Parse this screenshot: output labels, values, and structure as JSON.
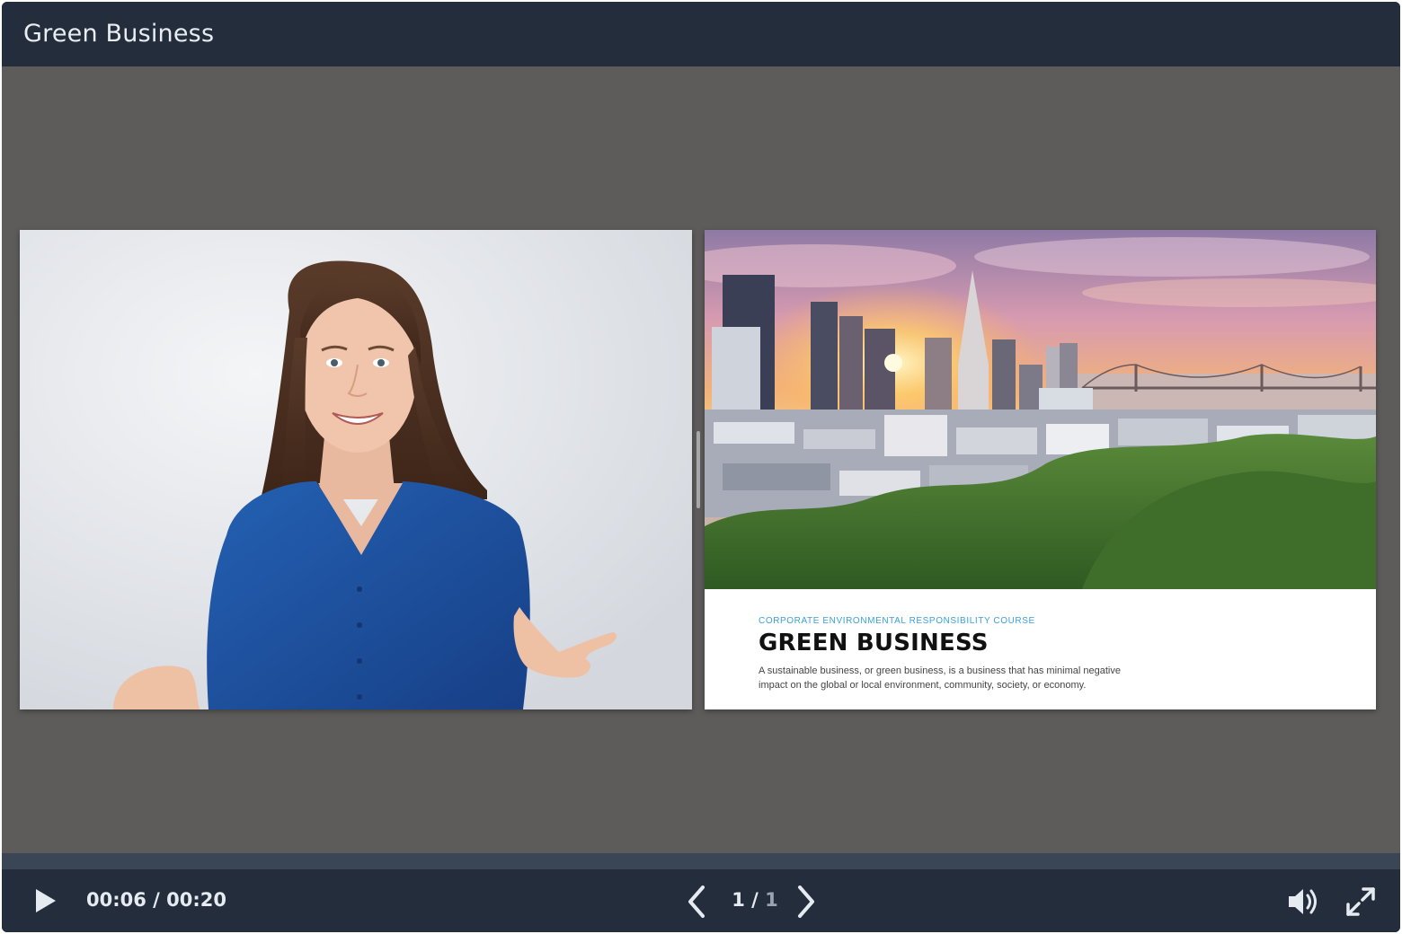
{
  "window": {
    "title": "Green Business"
  },
  "slide": {
    "kicker": "CORPORATE ENVIRONMENTAL RESPONSIBILITY COURSE",
    "heading": "GREEN BUSINESS",
    "body": "A sustainable business, or green business, is a business that has minimal negative impact on the global or local environment, community, society, or economy."
  },
  "player": {
    "current_time": "00:06",
    "separator": " / ",
    "duration": "00:20",
    "page_current": "1",
    "page_separator": " / ",
    "page_total": "1",
    "progress_fraction": 0.3
  },
  "icons": {
    "play": "play-icon",
    "prev": "chevron-left-icon",
    "next": "chevron-right-icon",
    "volume": "volume-icon",
    "fullscreen": "expand-icon"
  },
  "colors": {
    "header_bg": "#232d3b",
    "stage_bg": "#5d5c5b",
    "accent_text": "#3ba0d8",
    "shirt": "#1c4f9e"
  }
}
